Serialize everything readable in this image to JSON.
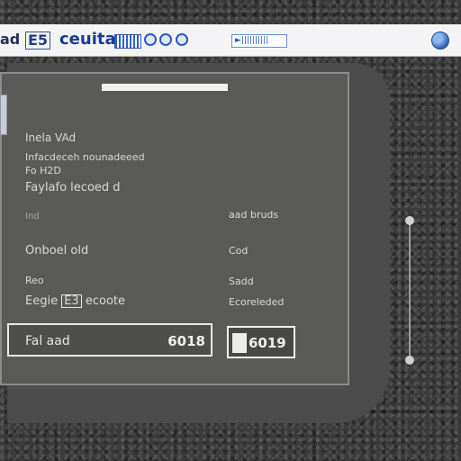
{
  "toolbar": {
    "first": "ad",
    "badge": "E5",
    "title": "ceuita",
    "field_value": "►||||||||||"
  },
  "dialog": {
    "title": "Inela VAd",
    "line1": "Infacdeceh nounadeeed",
    "line2": "Fo H2D",
    "line3": "Faylafo lecoed d",
    "row1": {
      "label": "Ind",
      "value": "aad bruds"
    },
    "row2": {
      "label": "Onboel old",
      "value": "Cod"
    },
    "row3": {
      "label": "Reo",
      "value": "Sadd"
    },
    "row4": {
      "label": "Eegie",
      "badge": "E3",
      "suffix": "ecoote",
      "value": "Ecoreleded"
    },
    "input": {
      "label": "Fal aad",
      "value": "6018"
    },
    "confirm_label": "6019"
  },
  "icons": {
    "globe": "globe-icon",
    "nav_circles": [
      "circle-icon",
      "circle-icon",
      "circle-icon"
    ],
    "stripes": "barcode-icon",
    "file": "document-icon"
  },
  "colors": {
    "toolbar_bg": "#f4f4f6",
    "accent": "#1d3f86",
    "dialog_bg": "#5a5b59"
  }
}
